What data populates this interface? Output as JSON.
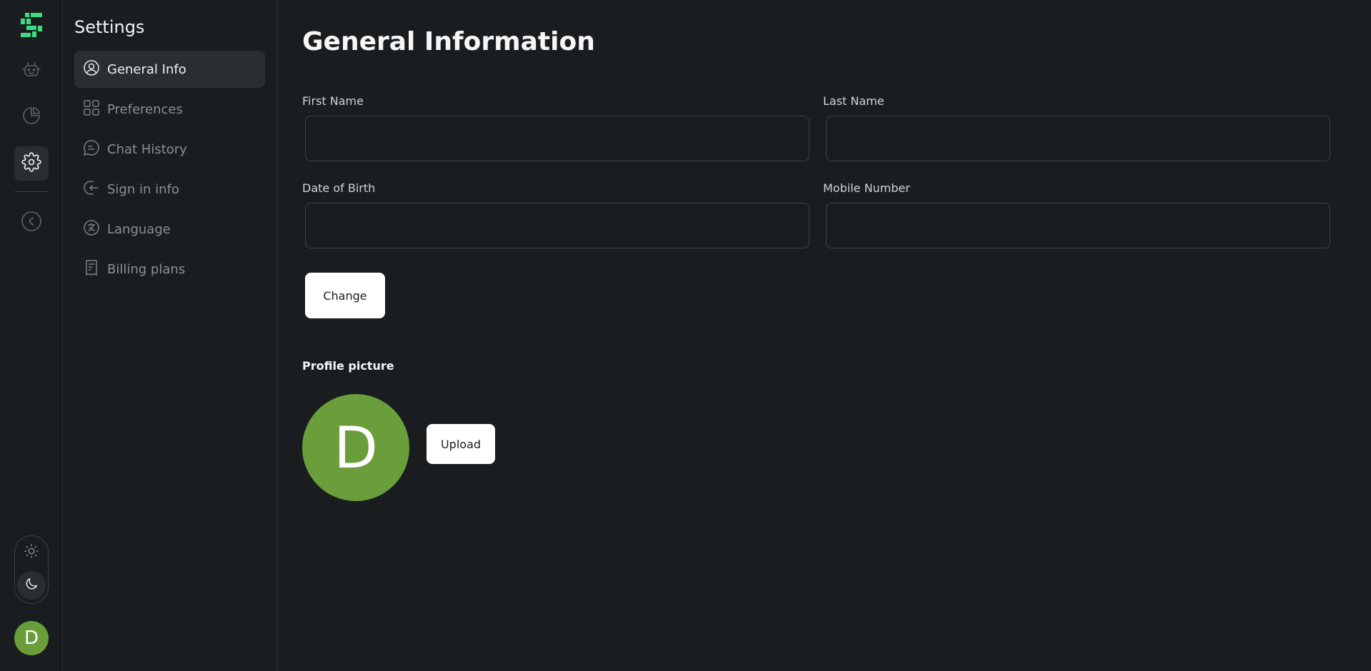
{
  "rail": {
    "logo": "brand-logo",
    "items": [
      {
        "icon": "robot-icon",
        "active": false
      },
      {
        "icon": "pie-chart-icon",
        "active": false
      },
      {
        "icon": "gear-icon",
        "active": true
      },
      {
        "icon": "chevron-left-circle-icon",
        "active": false
      }
    ],
    "theme": {
      "light_icon": "sun-icon",
      "dark_icon": "moon-icon",
      "selected": "dark"
    },
    "avatar_initial": "D"
  },
  "settings": {
    "title": "Settings",
    "items": [
      {
        "label": "General Info",
        "icon": "user-circle-icon",
        "active": true
      },
      {
        "label": "Preferences",
        "icon": "grid-icon",
        "active": false
      },
      {
        "label": "Chat History",
        "icon": "chat-bubble-icon",
        "active": false
      },
      {
        "label": "Sign in info",
        "icon": "sign-in-icon",
        "active": false
      },
      {
        "label": "Language",
        "icon": "language-icon",
        "active": false
      },
      {
        "label": "Billing plans",
        "icon": "receipt-icon",
        "active": false
      }
    ]
  },
  "main": {
    "title": "General Information",
    "fields": {
      "first_name": {
        "label": "First Name",
        "value": "",
        "placeholder": ""
      },
      "last_name": {
        "label": "Last Name",
        "value": "",
        "placeholder": ""
      },
      "dob": {
        "label": "Date of Birth",
        "value": "",
        "placeholder": ""
      },
      "mobile": {
        "label": "Mobile Number",
        "value": "",
        "placeholder": ""
      }
    },
    "change_label": "Change",
    "profile_picture_label": "Profile picture",
    "avatar_initial": "D",
    "upload_label": "Upload"
  },
  "colors": {
    "background": "#1a1d20",
    "panel_active": "#2a2e33",
    "avatar_green": "#6a9e3a",
    "brand_green": "#3ddc84"
  }
}
